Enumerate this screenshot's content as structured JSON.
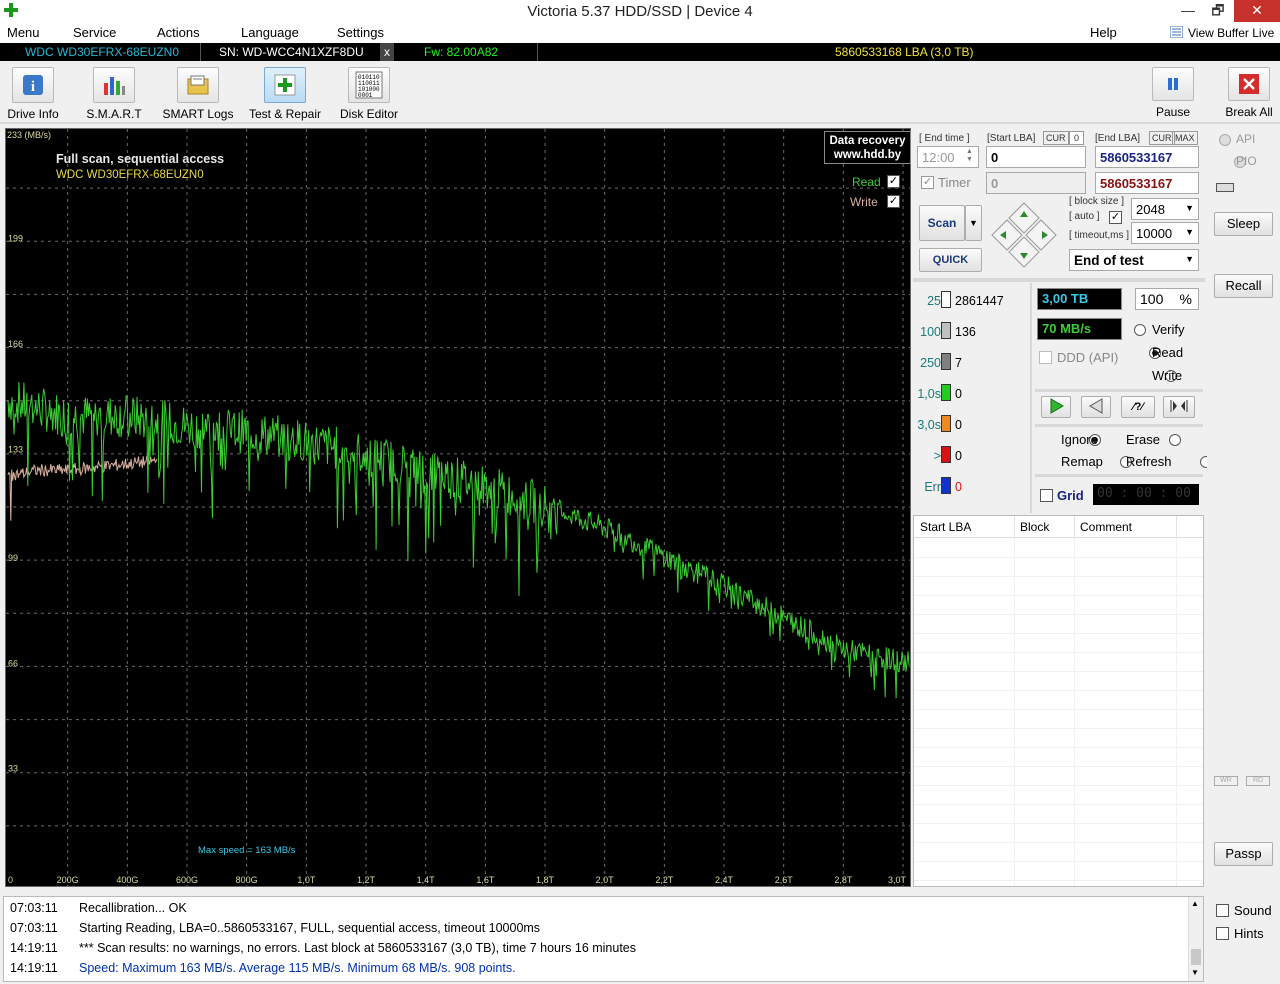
{
  "window": {
    "title": "Victoria 5.37 HDD/SSD | Device 4",
    "min": "—",
    "max": "🗗",
    "close": "✕"
  },
  "menu": {
    "items": [
      "Menu",
      "Service",
      "Actions",
      "Language",
      "Settings"
    ],
    "help": "Help",
    "view_buffer": "View Buffer Live"
  },
  "device": {
    "model": "WDC WD30EFRX-68EUZN0",
    "serial": "SN: WD-WCC4N1XZF8DU",
    "close": "x",
    "firmware": "Fw: 82.00A82",
    "lba": "5860533168 LBA (3,0 TB)"
  },
  "toolbar": {
    "buttons": [
      "Drive Info",
      "S.M.A.R.T",
      "SMART Logs",
      "Test & Repair",
      "Disk Editor"
    ],
    "pause": "Pause",
    "break_all": "Break All"
  },
  "chart": {
    "unit_label": "233 (MB/s)",
    "title": "Full scan, sequential access",
    "subtitle": "WDC WD30EFRX-68EUZN0",
    "badge_line1": "Data recovery",
    "badge_line2": "www.hdd.by",
    "legend_read": "Read",
    "legend_write": "Write",
    "max_speed_note": "Max speed = 163 MB/s",
    "colors": {
      "read": "#3ccc33",
      "write": "#d8b0a0",
      "grid": "#6a6a6a",
      "text": "#d8d8a0"
    }
  },
  "chart_data": {
    "type": "line",
    "title": "Full scan, sequential access",
    "ylabel": "(MB/s)",
    "ylim": [
      0,
      233
    ],
    "y_ticks": [
      "199",
      "166",
      "133",
      "99",
      "66",
      "33"
    ],
    "y_tick_values": [
      199,
      166,
      133,
      99,
      66,
      33
    ],
    "x_ticks": [
      "0",
      "200G",
      "400G",
      "600G",
      "800G",
      "1,0T",
      "1,2T",
      "1,4T",
      "1,6T",
      "1,8T",
      "2,0T",
      "2,2T",
      "2,4T",
      "2,6T",
      "2,8T",
      "3,0T"
    ],
    "xlim_tb": [
      0,
      3.02
    ],
    "series": [
      {
        "name": "Read",
        "x_tb": [
          0,
          0.2,
          0.4,
          0.6,
          0.8,
          1.0,
          1.2,
          1.4,
          1.6,
          1.8,
          2.0,
          2.2,
          2.4,
          2.6,
          2.8,
          3.0,
          3.02
        ],
        "values": [
          150,
          145,
          145,
          142,
          140,
          137,
          133,
          128,
          123,
          117,
          110,
          101,
          92,
          82,
          72,
          68,
          68
        ]
      },
      {
        "name": "Write",
        "x_tb": [
          0,
          0.1,
          0.2,
          0.4,
          0.5
        ],
        "values": [
          126,
          128,
          128,
          130,
          131
        ]
      }
    ]
  },
  "panel": {
    "end_time_label": "[ End time ]",
    "start_lba_label": "[Start LBA]",
    "cur_label": "CUR",
    "cur_value": "0",
    "end_lba_label": "[End LBA]",
    "max_label": "MAX",
    "end_time": "12:00",
    "start_lba": "0",
    "end_lba": "5860533167",
    "timer_label": "Timer",
    "timer_value": "0",
    "end_lba_cur": "5860533167",
    "scan": "Scan",
    "quick": "QUICK",
    "block_size_label": "[ block size ]",
    "auto_label": "[ auto ]",
    "block_size": "2048",
    "timeout_label": "[ timeout,ms ]",
    "timeout": "10000",
    "end_action": "End of test",
    "stats": [
      {
        "label": "25",
        "value": "2861447",
        "color": "#ffffff",
        "label_color": "#1a7a7a"
      },
      {
        "label": "100",
        "value": "136",
        "color": "#c0c0c0",
        "label_color": "#1a7a7a"
      },
      {
        "label": "250",
        "value": "7",
        "color": "#808080",
        "label_color": "#1a7a7a"
      },
      {
        "label": "1,0s",
        "value": "0",
        "color": "#22cc22",
        "label_color": "#1a7a7a"
      },
      {
        "label": "3,0s",
        "value": "0",
        "color": "#ee8822",
        "label_color": "#1a7a7a"
      },
      {
        "label": ">",
        "value": "0",
        "color": "#dd1111",
        "label_color": "#1a7a7a"
      },
      {
        "label": "Err",
        "value": "0",
        "color": "#1133cc",
        "label_color": "#1a7a7a"
      }
    ],
    "size": "3,00 TB",
    "percent": "100",
    "percent_sign": "%",
    "speed": "70 MB/s",
    "ddd": "DDD (API)",
    "mode_verify": "Verify",
    "mode_read": "Read",
    "mode_write": "Write",
    "act_ignore": "Ignore",
    "act_erase": "Erase",
    "act_remap": "Remap",
    "act_refresh": "Refresh",
    "grid": "Grid",
    "timer_display": "00 : 00 : 00",
    "table_headers": [
      "Start LBA",
      "Block",
      "Comment"
    ]
  },
  "farright": {
    "api": "API",
    "pio": "PIO",
    "sleep": "Sleep",
    "recall": "Recall",
    "passp": "Passp",
    "wr": "WR",
    "rd": "RD"
  },
  "log": [
    {
      "time": "07:03:11",
      "text": "Recallibration... OK",
      "color": "#000000"
    },
    {
      "time": "07:03:11",
      "text": "Starting Reading, LBA=0..5860533167, FULL, sequential access, timeout 10000ms",
      "color": "#000000"
    },
    {
      "time": "14:19:11",
      "text": "*** Scan results: no warnings, no errors. Last block at 5860533167 (3,0 TB), time 7 hours 16 minutes",
      "color": "#000000"
    },
    {
      "time": "14:19:11",
      "text": "Speed: Maximum 163 MB/s. Average 115 MB/s. Minimum 68 MB/s. 908 points.",
      "color": "#0033aa"
    }
  ],
  "options": {
    "sound": "Sound",
    "hints": "Hints"
  }
}
